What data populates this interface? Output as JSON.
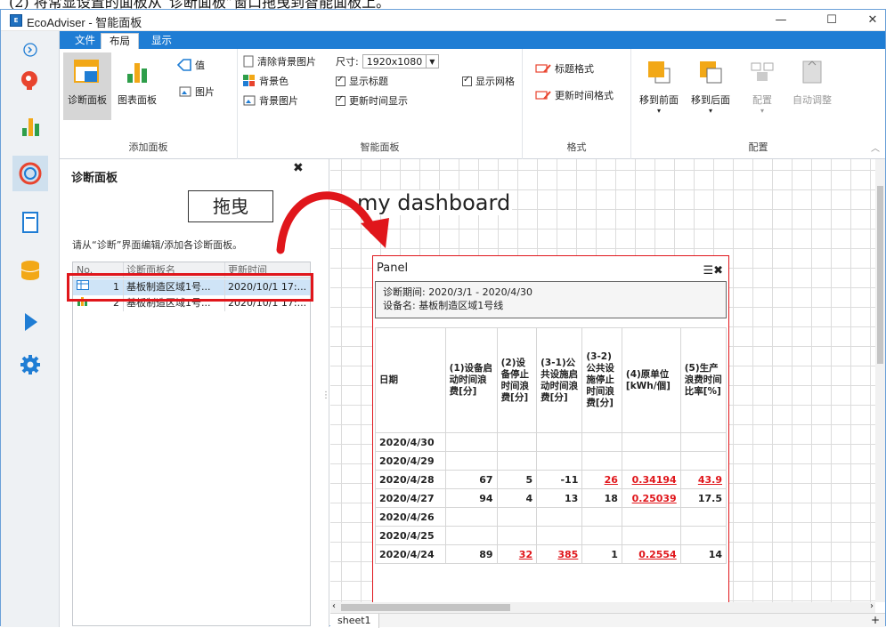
{
  "caption": "(2) 将常显设置的面板从“诊断面板”窗口拖曳到智能面板上。",
  "window": {
    "title": "EcoAdviser - 智能面板",
    "app_icon": "E"
  },
  "ribbon_tabs": [
    "文件",
    "布局",
    "显示"
  ],
  "ribbon": {
    "add_panel": {
      "label": "添加面板",
      "diag": "诊断面板",
      "chart": "图表面板",
      "value": "值",
      "image": "图片"
    },
    "smart": {
      "label": "智能面板",
      "clear_bg": "清除背景图片",
      "bg_color": "背景色",
      "bg_image": "背景图片",
      "size_label": "尺寸:",
      "size_value": "1920x1080",
      "show_title": "显示标题",
      "show_update": "更新时间显示",
      "show_grid": "显示网格"
    },
    "format": {
      "label": "格式",
      "title_fmt": "标题格式",
      "update_fmt": "更新时间格式"
    },
    "arrange": {
      "label": "配置",
      "front": "移到前面",
      "back": "移到后面",
      "config": "配置",
      "auto": "自动调整"
    }
  },
  "diag_panel": {
    "title": "诊断面板",
    "hint": "请从“诊断”界面编辑/添加各诊断面板。",
    "columns": [
      "No.",
      "诊断面板名",
      "更新时间"
    ],
    "rows": [
      {
        "no": "1",
        "name": "基板制造区域1号...",
        "time": "2020/10/1 17:..."
      },
      {
        "no": "2",
        "name": "基板制造区域1号...",
        "time": "2020/10/1 17:..."
      }
    ]
  },
  "drag_label": "拖曳",
  "dashboard": {
    "title": "my dashboard",
    "sheet": "sheet1"
  },
  "panel_widget": {
    "title": "Panel",
    "period": "诊断期间: 2020/3/1 - 2020/4/30",
    "device": "设备名: 基板制造区域1号线",
    "headers": [
      "日期",
      "(1)设备启动时间浪费[分]",
      "(2)设备停止时间浪费[分]",
      "(3-1)公共设施启动时间浪费[分]",
      "(3-2)公共设施停止时间浪费[分]",
      "(4)原单位[kWh/個]",
      "(5)生产浪费时间比率[%]"
    ],
    "rows": [
      [
        "2020/4/30",
        "",
        "",
        "",
        "",
        "",
        ""
      ],
      [
        "2020/4/29",
        "",
        "",
        "",
        "",
        "",
        ""
      ],
      [
        "2020/4/28",
        "67",
        "5",
        "-11",
        "26",
        "0.34194",
        "43.9"
      ],
      [
        "2020/4/27",
        "94",
        "4",
        "13",
        "18",
        "0.25039",
        "17.5"
      ],
      [
        "2020/4/26",
        "",
        "",
        "",
        "",
        "",
        ""
      ],
      [
        "2020/4/25",
        "",
        "",
        "",
        "",
        "",
        ""
      ],
      [
        "2020/4/24",
        "89",
        "32",
        "385",
        "1",
        "0.2554",
        "14"
      ]
    ],
    "red_cells": [
      "2-4",
      "2-5",
      "2-6",
      "3-5",
      "6-2",
      "6-3",
      "6-5"
    ]
  }
}
